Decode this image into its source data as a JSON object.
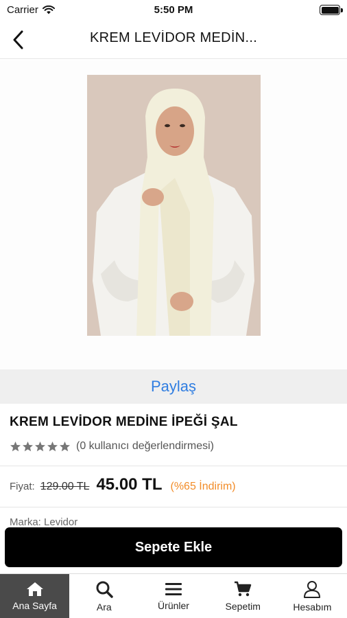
{
  "status": {
    "carrier": "Carrier",
    "time": "5:50 PM",
    "battery_level": 1.0
  },
  "nav": {
    "title": "KREM LEVİDOR MEDİN..."
  },
  "share": {
    "label": "Paylaş"
  },
  "product": {
    "name": "KREM LEVİDOR MEDİNE İPEĞİ ŞAL",
    "rating_stars": 5,
    "rating_text": "(0 kullanıcı değerlendirmesi)",
    "price_label": "Fiyat:",
    "old_price": "129.00 TL",
    "new_price": "45.00 TL",
    "discount": "(%65  İndirim)",
    "brand_peek": "Marka:  Levidor"
  },
  "cart": {
    "button_label": "Sepete Ekle"
  },
  "tabs": [
    {
      "label": "Ana Sayfa",
      "icon": "home-icon",
      "active": true
    },
    {
      "label": "Ara",
      "icon": "search-icon",
      "active": false
    },
    {
      "label": "Ürünler",
      "icon": "menu-icon",
      "active": false
    },
    {
      "label": "Sepetim",
      "icon": "cart-icon",
      "active": false
    },
    {
      "label": "Hesabım",
      "icon": "user-icon",
      "active": false
    }
  ],
  "colors": {
    "share_link": "#2f7de1",
    "discount": "#f28c28",
    "cart_button": "#000000",
    "active_tab": "#4a4a4a"
  }
}
